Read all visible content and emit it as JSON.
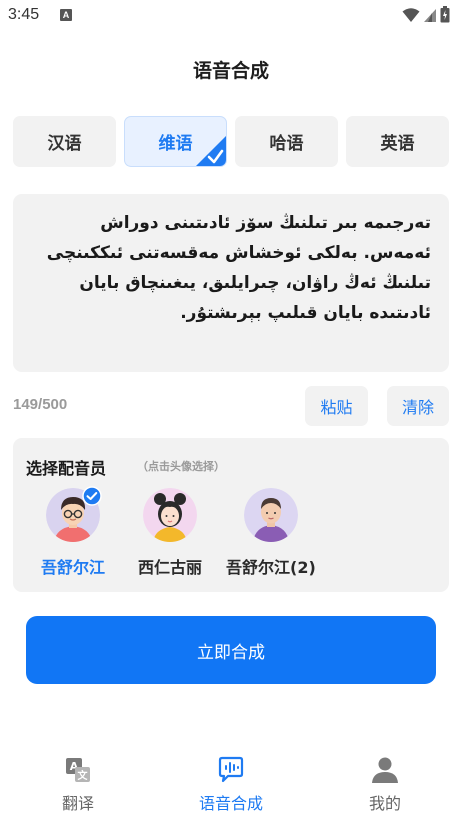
{
  "status": {
    "time": "3:45",
    "notification_badge": "A"
  },
  "header": {
    "title": "语音合成"
  },
  "languages": [
    {
      "label": "汉语",
      "selected": false
    },
    {
      "label": "维语",
      "selected": true
    },
    {
      "label": "哈语",
      "selected": false
    },
    {
      "label": "英语",
      "selected": false
    }
  ],
  "editor": {
    "text": "تەرجىمە بىر تىلنىڭ سۆز ئادىتىنى دوراش ئەمەس. بەلكى ئوخشاش مەقسەتنى ئىككىنچى تىلنىڭ ئەڭ راۋان، چىرايلىق، يىغىنچاق بايان ئادىتىدە بايان قىلىپ بېرىشتۇر.",
    "char_count": "149/500",
    "paste_label": "粘贴",
    "clear_label": "清除"
  },
  "voices": {
    "title": "选择配音员",
    "hint": "（点击头像选择）",
    "speakers": [
      {
        "name": "吾舒尔江",
        "selected": true,
        "avatar_icon": "man-glasses-avatar"
      },
      {
        "name": "西仁古丽",
        "selected": false,
        "avatar_icon": "woman-buns-avatar"
      },
      {
        "name": "吾舒尔江(2)",
        "selected": false,
        "avatar_icon": "man-avatar"
      }
    ]
  },
  "actions": {
    "synthesize_label": "立即合成"
  },
  "nav": {
    "items": [
      {
        "label": "翻译",
        "icon": "translate-icon",
        "active": false
      },
      {
        "label": "语音合成",
        "icon": "speech-bubble-icon",
        "active": true
      },
      {
        "label": "我的",
        "icon": "person-icon",
        "active": false
      }
    ]
  },
  "colors": {
    "accent": "#1176f5",
    "panel": "#f2f2f2",
    "muted": "#9a9a9a"
  }
}
